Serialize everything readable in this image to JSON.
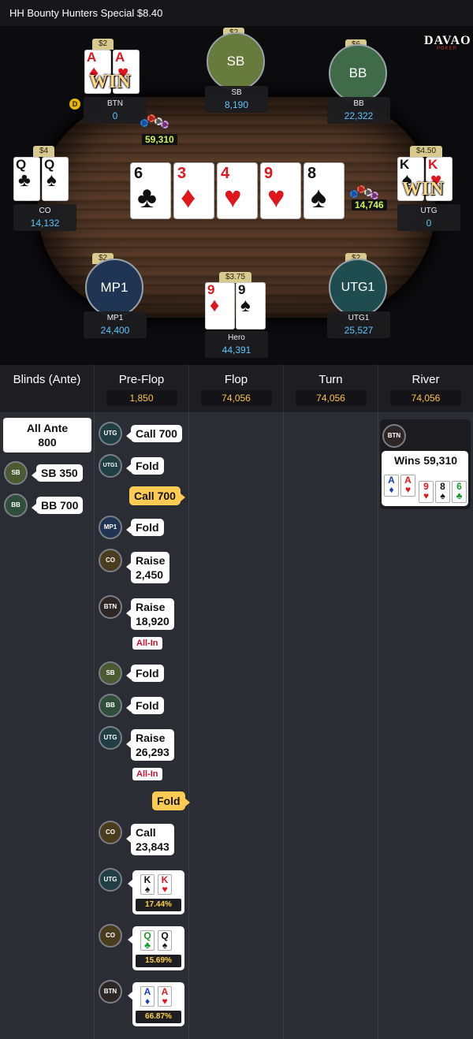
{
  "title": "HH  Bounty Hunters Special $8.40",
  "logo": {
    "main": "DAVAO",
    "sub": "POKER"
  },
  "seats": {
    "btn": {
      "name": "BTN",
      "stack": "0",
      "bounty": "$2",
      "cards": [
        {
          "rank": "A",
          "suit": "♦"
        },
        {
          "rank": "A",
          "suit": "♥"
        }
      ],
      "win": "WIN",
      "dealer": "D"
    },
    "sb": {
      "name": "SB",
      "stack": "8,190",
      "bounty": "$2",
      "avatar": "SB"
    },
    "bb": {
      "name": "BB",
      "stack": "22,322",
      "bounty": "$6",
      "avatar": "BB"
    },
    "co": {
      "name": "CO",
      "stack": "14,132",
      "bounty": "$4",
      "cards": [
        {
          "rank": "Q",
          "suit": "♣"
        },
        {
          "rank": "Q",
          "suit": "♠"
        }
      ]
    },
    "utg": {
      "name": "UTG",
      "stack": "0",
      "bounty": "$4.50",
      "cards": [
        {
          "rank": "K",
          "suit": "♠"
        },
        {
          "rank": "K",
          "suit": "♥"
        }
      ],
      "win": "WIN"
    },
    "mp1": {
      "name": "MP1",
      "stack": "24,400",
      "bounty": "$2",
      "avatar": "MP1"
    },
    "hero": {
      "name": "Hero",
      "stack": "44,391",
      "bounty": "$3.75",
      "cards": [
        {
          "rank": "9",
          "suit": "♦"
        },
        {
          "rank": "9",
          "suit": "♠"
        }
      ]
    },
    "utg1": {
      "name": "UTG1",
      "stack": "25,527",
      "bounty": "$2",
      "avatar": "UTG1"
    }
  },
  "pots": {
    "left": "59,310",
    "right": "14,746"
  },
  "board": [
    {
      "rank": "6",
      "suit": "♣"
    },
    {
      "rank": "3",
      "suit": "♦"
    },
    {
      "rank": "4",
      "suit": "♥"
    },
    {
      "rank": "9",
      "suit": "♥"
    },
    {
      "rank": "8",
      "suit": "♠"
    }
  ],
  "streets": {
    "blinds": {
      "label": "Blinds (Ante)"
    },
    "preflop": {
      "label": "Pre-Flop",
      "pot": "1,850"
    },
    "flop": {
      "label": "Flop",
      "pot": "74,056"
    },
    "turn": {
      "label": "Turn",
      "pot": "74,056"
    },
    "river": {
      "label": "River",
      "pot": "74,056"
    }
  },
  "blinds_actions": {
    "ante": {
      "line1": "All Ante",
      "line2": "800"
    },
    "sb": {
      "badge": "SB",
      "text": "SB  350"
    },
    "bb": {
      "badge": "BB",
      "text": "BB  700"
    }
  },
  "preflop_actions": {
    "a1": {
      "badge": "UTG",
      "text": "Call  700"
    },
    "a2": {
      "badge": "UTG1",
      "text": "Fold"
    },
    "a3": {
      "text": "Call  700"
    },
    "a4": {
      "badge": "MP1",
      "text": "Fold"
    },
    "a5": {
      "badge": "CO",
      "line1": "Raise",
      "line2": "2,450"
    },
    "a6": {
      "badge": "BTN",
      "line1": "Raise",
      "line2": "18,920",
      "allin": "All-In"
    },
    "a7": {
      "badge": "SB",
      "text": "Fold"
    },
    "a8": {
      "badge": "BB",
      "text": "Fold"
    },
    "a9": {
      "badge": "UTG",
      "line1": "Raise",
      "line2": "26,293",
      "allin": "All-In"
    },
    "a10": {
      "text": "Fold"
    },
    "a11": {
      "badge": "CO",
      "line1": "Call",
      "line2": "23,843"
    }
  },
  "equity": {
    "utg": {
      "badge": "UTG",
      "cards": [
        {
          "rank": "K",
          "suit": "♠"
        },
        {
          "rank": "K",
          "suit": "♥"
        }
      ],
      "pct": "17.44%"
    },
    "co": {
      "badge": "CO",
      "cards": [
        {
          "rank": "Q",
          "suit": "♣"
        },
        {
          "rank": "Q",
          "suit": "♠"
        }
      ],
      "pct": "15.69%"
    },
    "btn": {
      "badge": "BTN",
      "cards": [
        {
          "rank": "A",
          "suit": "♦"
        },
        {
          "rank": "A",
          "suit": "♥"
        }
      ],
      "pct": "66.87%"
    }
  },
  "river_result": {
    "badge": "BTN",
    "text": "Wins 59,310",
    "cards": [
      {
        "rank": "A",
        "suit": "♦"
      },
      {
        "rank": "A",
        "suit": "♥"
      },
      {
        "rank": "9",
        "suit": "♥"
      },
      {
        "rank": "8",
        "suit": "♠"
      },
      {
        "rank": "6",
        "suit": "♣"
      }
    ]
  },
  "colors": {
    "stack": "#5ec6ff",
    "pot": "#ffc24e",
    "chip_amount": "#cff25a",
    "sb_avatar": "#677b3c",
    "bb_avatar": "#3f6b48",
    "mp1_avatar": "#1f3553",
    "utg1_avatar": "#1f4c4f"
  }
}
